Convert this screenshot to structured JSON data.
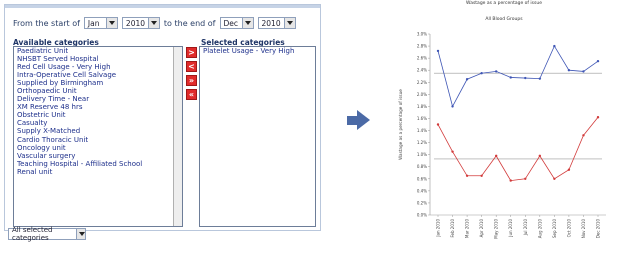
{
  "date_range": {
    "prefix": "From the start of",
    "start_month": "Jan",
    "start_year": "2010",
    "middle": "to the end of",
    "end_month": "Dec",
    "end_year": "2010"
  },
  "available": {
    "label": "Available categories",
    "items": [
      "Paediatric Unit",
      "NHSBT Served Hospital",
      "Red Cell Usage - Very High",
      "Intra-Operative Cell Salvage",
      "Supplied by Birmingham",
      "Orthopaedic Unit",
      "Delivery Time - Near",
      "XM Reserve 48 hrs",
      "Obstetric Unit",
      "Casualty",
      "Supply X-Matched",
      "Cardio Thoracic Unit",
      "Oncology unit",
      "Vascular surgery",
      "Teaching Hospital - Affiliated School",
      "Renal unit"
    ]
  },
  "selected": {
    "label": "Selected categories",
    "items": [
      "Platelet Usage - Very High"
    ]
  },
  "transfer_buttons": [
    ">",
    "<",
    "»",
    "«"
  ],
  "filter": {
    "value": "All selected categories"
  },
  "colors": {
    "accent_red": "#e02b2b",
    "list_text": "#1d2f8b",
    "flow_arrow": "#4b6aa6",
    "series_blue": "#3f56b5",
    "series_red": "#d23b3b"
  },
  "chart_data": {
    "type": "line",
    "title": "Wastage as a percentage of issue",
    "subtitle": "All Blood Groups",
    "ylabel": "Wastage as a percentage of issue",
    "xlabel": "",
    "ylim": [
      0,
      3.0
    ],
    "yticks": [
      "0.0%",
      "0.2%",
      "0.4%",
      "0.6%",
      "0.8%",
      "1.0%",
      "1.2%",
      "1.4%",
      "1.6%",
      "1.8%",
      "2.0%",
      "2.2%",
      "2.4%",
      "2.6%",
      "2.8%",
      "3.0%"
    ],
    "categories": [
      "Jan 2010",
      "Feb 2010",
      "Mar 2010",
      "Apr 2010",
      "May 2010",
      "Jun 2010",
      "Jul 2010",
      "Aug 2010",
      "Sep 2010",
      "Oct 2010",
      "Nov 2010",
      "Dec 2010"
    ],
    "series": [
      {
        "color": "#3f56b5",
        "values": [
          2.72,
          1.8,
          2.25,
          2.35,
          2.38,
          2.28,
          2.27,
          2.26,
          2.8,
          2.4,
          2.38,
          2.55
        ],
        "mean": 2.35
      },
      {
        "color": "#d23b3b",
        "values": [
          1.5,
          1.05,
          0.65,
          0.65,
          0.98,
          0.57,
          0.6,
          0.98,
          0.6,
          0.75,
          1.32,
          1.62
        ],
        "mean": 0.93
      }
    ],
    "grid": false,
    "legend": "none"
  }
}
